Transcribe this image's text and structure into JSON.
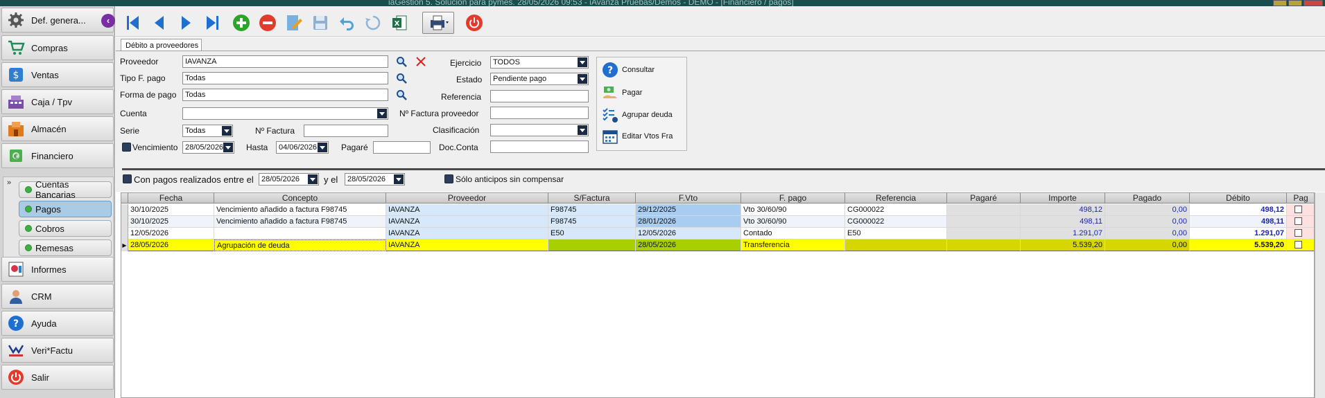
{
  "window": {
    "title": "iaGestion 5. Solución para pymes.  28/05/2026 09:53  -  iAvanza Pruebas/Demos - DEMO - [Financiero / pagos]"
  },
  "sidebar": {
    "items": [
      {
        "label": "Def. genera...",
        "icon": "gear-icon"
      },
      {
        "label": "Compras",
        "icon": "cart-icon"
      },
      {
        "label": "Ventas",
        "icon": "sales-icon"
      },
      {
        "label": "Caja / Tpv",
        "icon": "register-icon"
      },
      {
        "label": "Almacén",
        "icon": "warehouse-icon"
      },
      {
        "label": "Financiero",
        "icon": "money-icon"
      },
      {
        "label": "Informes",
        "icon": "report-icon"
      },
      {
        "label": "CRM",
        "icon": "person-icon"
      },
      {
        "label": "Ayuda",
        "icon": "help-icon"
      },
      {
        "label": "Veri*Factu",
        "icon": "verifactu-icon"
      },
      {
        "label": "Salir",
        "icon": "power-icon"
      }
    ],
    "subitems": [
      {
        "label": "Cuentas Bancarias",
        "active": false
      },
      {
        "label": "Pagos",
        "active": true
      },
      {
        "label": "Cobros",
        "active": false
      },
      {
        "label": "Remesas",
        "active": false
      }
    ],
    "collapse_glyph": "‹",
    "expand_glyph": "»"
  },
  "tab": {
    "label": "Débito a proveedores"
  },
  "filters": {
    "proveedor_label": "Proveedor",
    "proveedor_value": "IAVANZA",
    "tipo_label": "Tipo F. pago",
    "tipo_value": "Todas",
    "forma_label": "Forma de pago",
    "forma_value": "Todas",
    "cuenta_label": "Cuenta",
    "cuenta_value": "",
    "serie_label": "Serie",
    "serie_value": "Todas",
    "nfactura_label": "Nº Factura",
    "nfactura_value": "",
    "vencimiento_label": "Vencimiento",
    "vencimiento_value": "28/05/2026",
    "hasta_label": "Hasta",
    "hasta_value": "04/06/2026",
    "pagare_label": "Pagaré",
    "pagare_value": "",
    "ejercicio_label": "Ejercicio",
    "ejercicio_value": "TODOS",
    "estado_label": "Estado",
    "estado_value": "Pendiente pago",
    "referencia_label": "Referencia",
    "referencia_value": "",
    "nfactprov_label": "Nº Factura proveedor",
    "nfactprov_value": "",
    "clasificacion_label": "Clasificación",
    "clasificacion_value": "",
    "docconta_label": "Doc.Conta",
    "docconta_value": "",
    "pagos_label": "Con pagos realizados entre el",
    "pagos_desde": "28/05/2026",
    "y_label": "y el",
    "pagos_hasta": "28/05/2026",
    "anticipos_label": "Sólo anticipos sin compensar"
  },
  "actions": [
    {
      "label": "Consultar",
      "icon": "question-icon"
    },
    {
      "label": "Pagar",
      "icon": "pay-icon"
    },
    {
      "label": "Agrupar deuda",
      "icon": "group-debt-icon"
    },
    {
      "label": "Editar Vtos Fra",
      "icon": "calendar-icon"
    }
  ],
  "grid": {
    "columns": [
      "Fecha",
      "Concepto",
      "Proveedor",
      "S/Factura",
      "F.Vto",
      "F. pago",
      "Referencia",
      "Pagaré",
      "Importe",
      "Pagado",
      "Débito",
      "Pag"
    ],
    "rows": [
      {
        "fecha": "30/10/2025",
        "concepto": "Vencimiento añadido a factura F98745",
        "proveedor": "IAVANZA",
        "sfactura": "F98745",
        "fvto": "29/12/2025",
        "fpago": "Vto 30/60/90",
        "referencia": "CG000022",
        "pagare": "",
        "importe": "498,12",
        "pagado": "0,00",
        "debito": "498,12",
        "selected": false
      },
      {
        "fecha": "30/10/2025",
        "concepto": "Vencimiento añadido a factura F98745",
        "proveedor": "IAVANZA",
        "sfactura": "F98745",
        "fvto": "28/01/2026",
        "fpago": "Vto 30/60/90",
        "referencia": "CG000022",
        "pagare": "",
        "importe": "498,11",
        "pagado": "0,00",
        "debito": "498,11",
        "selected": false
      },
      {
        "fecha": "12/05/2026",
        "concepto": "",
        "proveedor": "IAVANZA",
        "sfactura": "E50",
        "fvto": "12/05/2026",
        "fpago": "Contado",
        "referencia": "E50",
        "pagare": "",
        "importe": "1.291,07",
        "pagado": "0,00",
        "debito": "1.291,07",
        "selected": false
      },
      {
        "fecha": "28/05/2026",
        "concepto": "Agrupación de deuda",
        "proveedor": "IAVANZA",
        "sfactura": "",
        "fvto": "28/05/2026",
        "fpago": "Transferencia",
        "referencia": "",
        "pagare": "",
        "importe": "5.539,20",
        "pagado": "0,00",
        "debito": "5.539,20",
        "selected": true
      }
    ]
  },
  "colors": {
    "accent": "#7b2da6",
    "selected_row": "#ffff00",
    "amount_blue": "#1a24b0"
  }
}
